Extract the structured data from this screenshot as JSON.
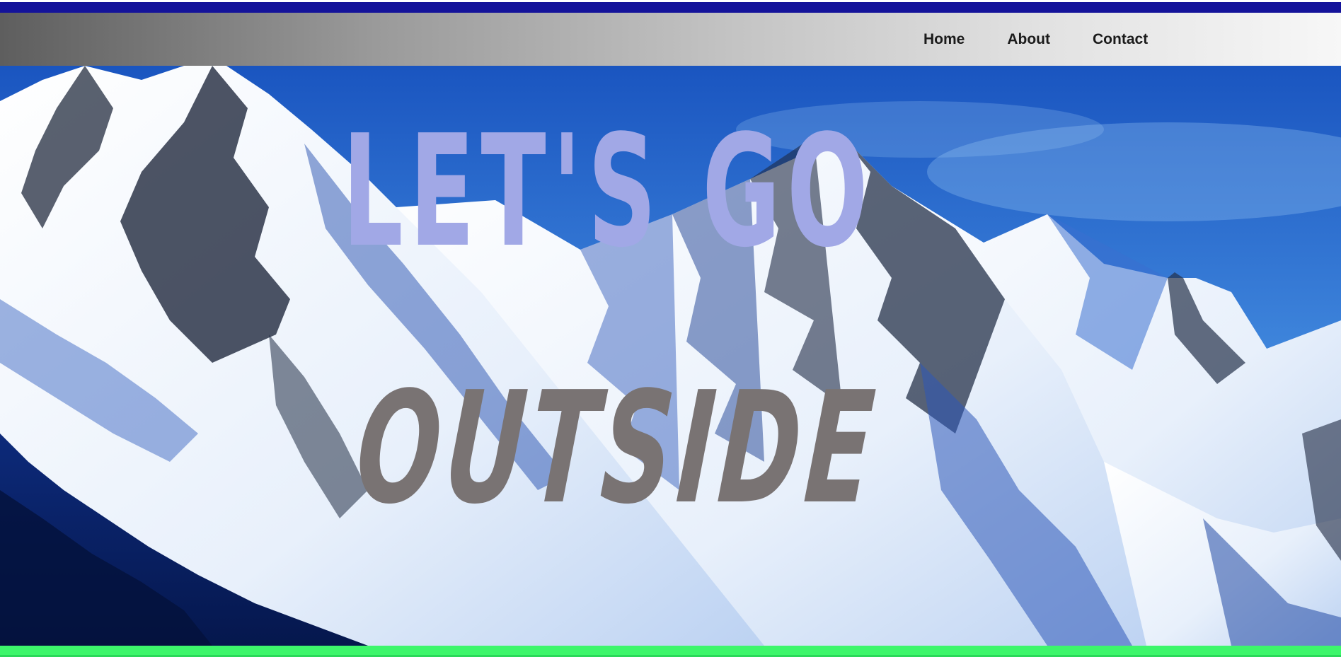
{
  "nav": {
    "links": [
      {
        "label": "Home"
      },
      {
        "label": "About"
      },
      {
        "label": "Contact"
      }
    ]
  },
  "hero": {
    "line1": "LET'S GO",
    "line2": "OUTSIDE",
    "background": "snow-capped-mountains-image"
  },
  "colors": {
    "top_bar": "#14139a",
    "title_line1": "#a1a8e6",
    "title_line2": "#797373",
    "bottom_bar": "#3df66b",
    "sky": "#1f63c8"
  }
}
